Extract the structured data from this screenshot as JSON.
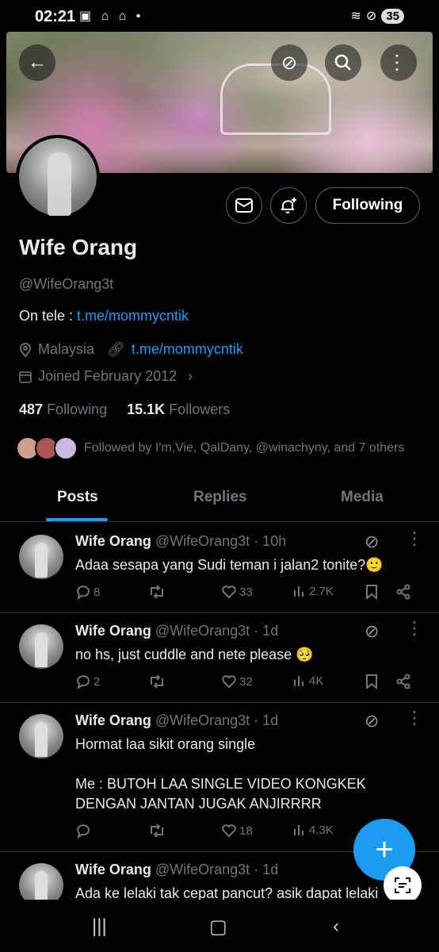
{
  "status_bar": {
    "time": "02:21",
    "battery": "35"
  },
  "profile": {
    "name": "Wife Orang",
    "handle": "@WifeOrang3t",
    "bio_prefix": "On tele : ",
    "bio_link": "t.me/mommycntik",
    "location": "Malaysia",
    "website": "t.me/mommycntik",
    "joined": "Joined February 2012",
    "following_count": "487",
    "following_label": "Following",
    "followers_count": "15.1K",
    "followers_label": "Followers",
    "followed_by": "Followed by I'm,Vie, QalDany, @winachyny, and 7 others",
    "follow_button": "Following"
  },
  "tabs": [
    {
      "label": "Posts",
      "active": true
    },
    {
      "label": "Replies",
      "active": false
    },
    {
      "label": "Media",
      "active": false
    }
  ],
  "posts": [
    {
      "name": "Wife Orang",
      "meta": "@WifeOrang3t · 10h",
      "text": "Adaa sesapa yang Sudi teman i jalan2 tonite?🙂",
      "replies": "8",
      "reposts": "",
      "likes": "33",
      "views": "2.7K"
    },
    {
      "name": "Wife Orang",
      "meta": "@WifeOrang3t · 1d",
      "text": "no hs, just cuddle and nete please 🥺",
      "replies": "2",
      "reposts": "",
      "likes": "32",
      "views": "4K"
    },
    {
      "name": "Wife Orang",
      "meta": "@WifeOrang3t · 1d",
      "text": "Hormat laa sikit orang single\n\nMe : BUTOH LAA SINGLE VIDEO KONGKEK DENGAN JANTAN JUGAK ANJIRRRR",
      "replies": "",
      "reposts": "",
      "likes": "18",
      "views": "4.3K"
    },
    {
      "name": "Wife Orang",
      "meta": "@WifeOrang3t · 1d",
      "text": "Ada ke lelaki tak cepat pancut? asik dapat lelaki"
    }
  ],
  "colors": {
    "accent": "#1d9bf0",
    "background": "#000000",
    "muted": "#71767b"
  }
}
